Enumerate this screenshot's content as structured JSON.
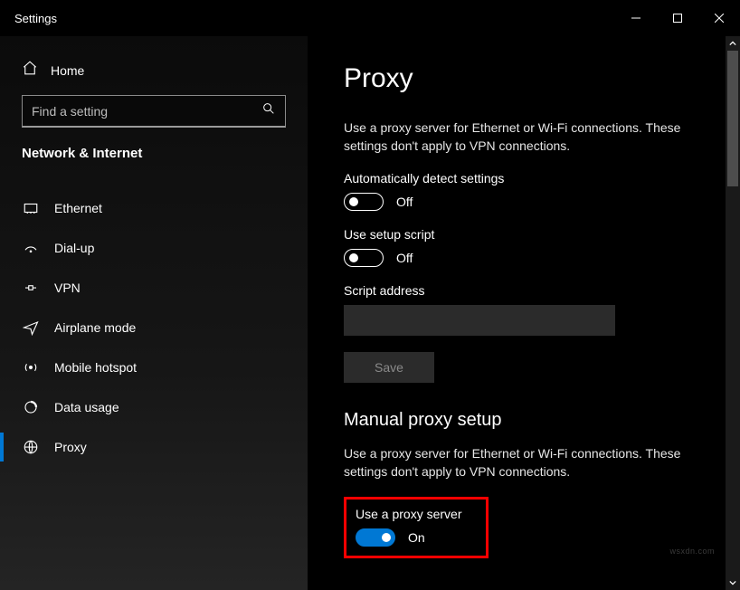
{
  "titlebar": {
    "title": "Settings"
  },
  "sidebar": {
    "home": "Home",
    "search_placeholder": "Find a setting",
    "section": "Network & Internet",
    "items": [
      {
        "label": "Ethernet"
      },
      {
        "label": "Dial-up"
      },
      {
        "label": "VPN"
      },
      {
        "label": "Airplane mode"
      },
      {
        "label": "Mobile hotspot"
      },
      {
        "label": "Data usage"
      },
      {
        "label": "Proxy"
      }
    ]
  },
  "main": {
    "title": "Proxy",
    "desc1": "Use a proxy server for Ethernet or Wi-Fi connections. These settings don't apply to VPN connections.",
    "auto_detect_label": "Automatically detect settings",
    "auto_detect_state": "Off",
    "setup_script_label": "Use setup script",
    "setup_script_state": "Off",
    "script_addr_label": "Script address",
    "script_addr_value": "",
    "save_label": "Save",
    "manual_heading": "Manual proxy setup",
    "desc2": "Use a proxy server for Ethernet or Wi-Fi connections. These settings don't apply to VPN connections.",
    "use_proxy_label": "Use a proxy server",
    "use_proxy_state": "On"
  },
  "watermark": "wsxdn.com"
}
